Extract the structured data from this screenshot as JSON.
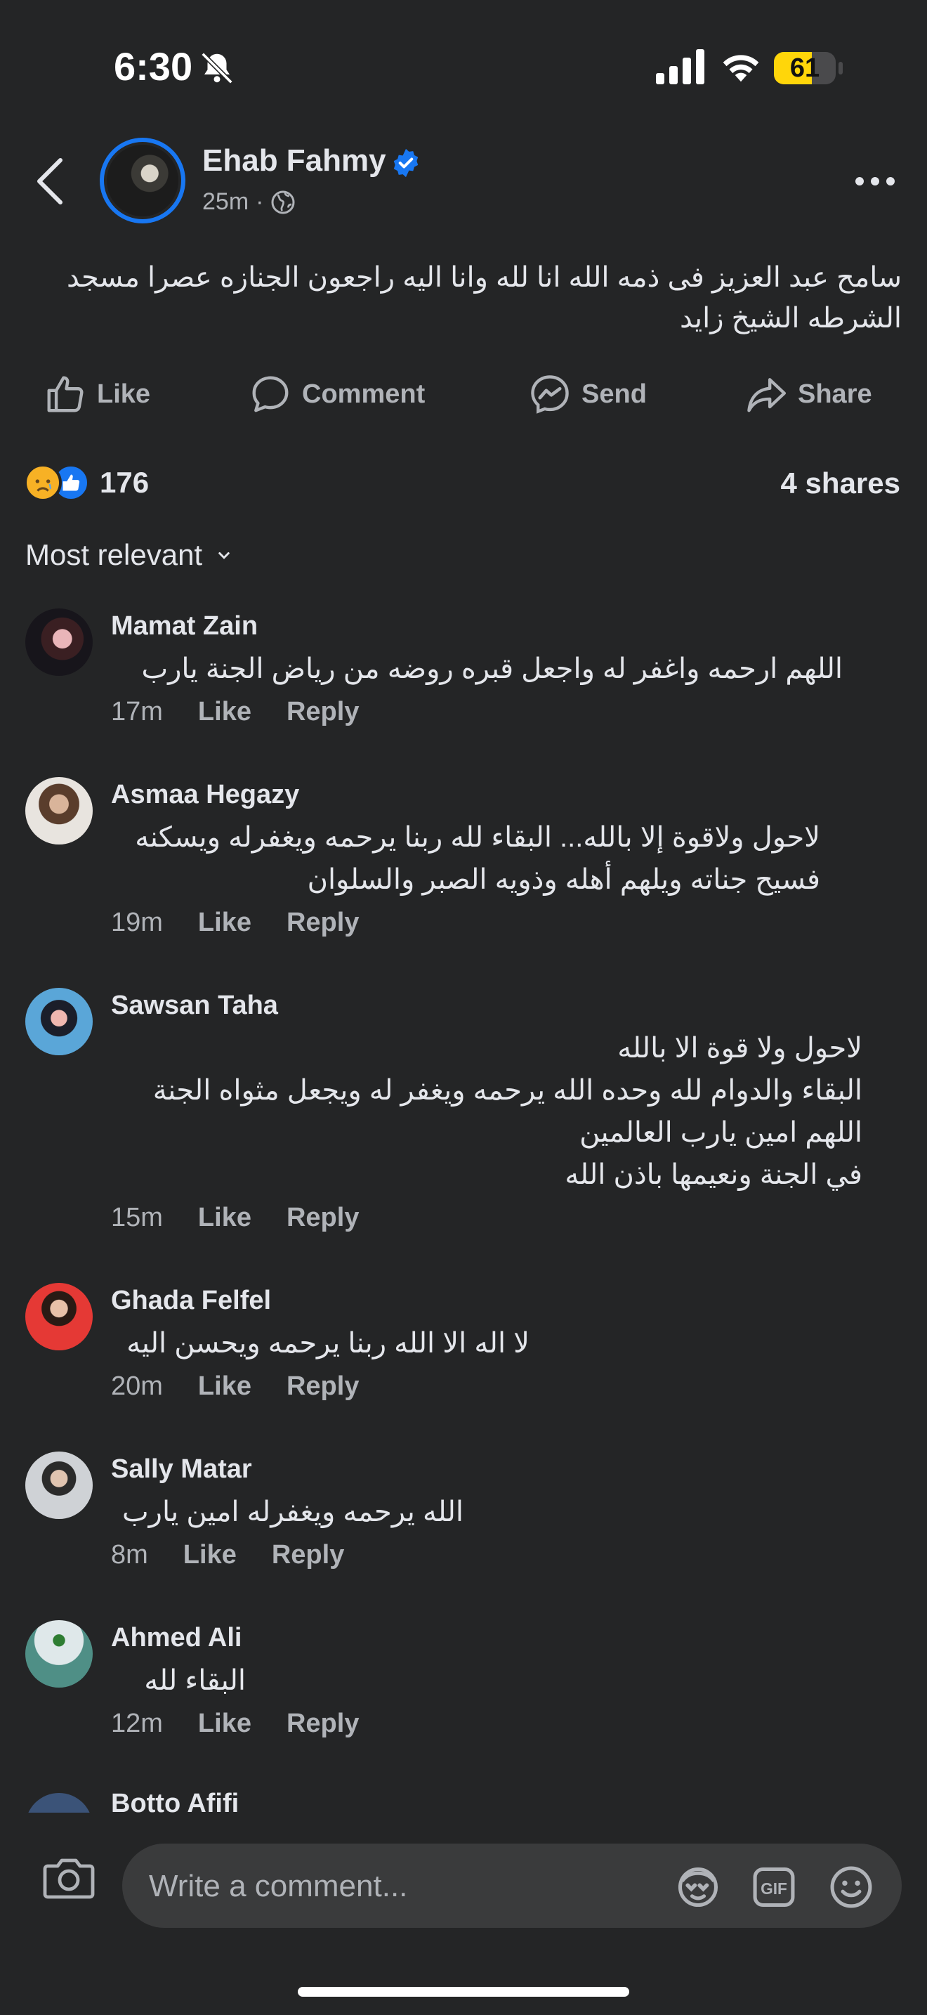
{
  "status_bar": {
    "time": "6:30",
    "battery": "61",
    "battery_level": 0.61
  },
  "post": {
    "author": "Ehab Fahmy",
    "time": "25m",
    "separator": "·",
    "text": "سامح عبد العزيز فى ذمه الله انا لله وانا اليه راجعون الجنازه عصرا مسجد الشرطه الشيخ زايد"
  },
  "actions": {
    "like": "Like",
    "comment": "Comment",
    "send": "Send",
    "share": "Share"
  },
  "stats": {
    "reaction_count": "176",
    "shares": "4 shares"
  },
  "sort": {
    "label": "Most relevant"
  },
  "comments": [
    {
      "name": "Mamat Zain",
      "text": "اللهم ارحمه واغفر له واجعل قبره روضه من رياض الجنة يارب",
      "time": "17m",
      "like": "Like",
      "reply": "Reply"
    },
    {
      "name": "Asmaa Hegazy",
      "text": "لاحول ولاقوة إلا بالله... البقاء لله ربنا يرحمه ويغفرله ويسكنه فسيح جناته ويلهم أهله وذويه الصبر والسلوان",
      "time": "19m",
      "like": "Like",
      "reply": "Reply"
    },
    {
      "name": "Sawsan Taha",
      "text": "لاحول ولا قوة الا بالله\nالبقاء والدوام لله وحده الله يرحمه ويغفر له ويجعل مثواه الجنة\nاللهم امين يارب العالمين\nفي الجنة ونعيمها باذن الله",
      "time": "15m",
      "like": "Like",
      "reply": "Reply"
    },
    {
      "name": "Ghada Felfel",
      "text": "لا اله الا الله ربنا يرحمه ويحسن اليه",
      "time": "20m",
      "like": "Like",
      "reply": "Reply"
    },
    {
      "name": "Sally Matar",
      "text": "الله يرحمه ويغفرله امين يارب",
      "time": "8m",
      "like": "Like",
      "reply": "Reply"
    },
    {
      "name": "Ahmed Ali",
      "text": "البقاء لله",
      "time": "12m",
      "like": "Like",
      "reply": "Reply"
    },
    {
      "name": "Botto Afifi"
    }
  ],
  "composer": {
    "placeholder": "Write a comment..."
  },
  "colors": {
    "background": "#242526",
    "accent": "#1877f2",
    "secondary_text": "#b0b3b8"
  }
}
